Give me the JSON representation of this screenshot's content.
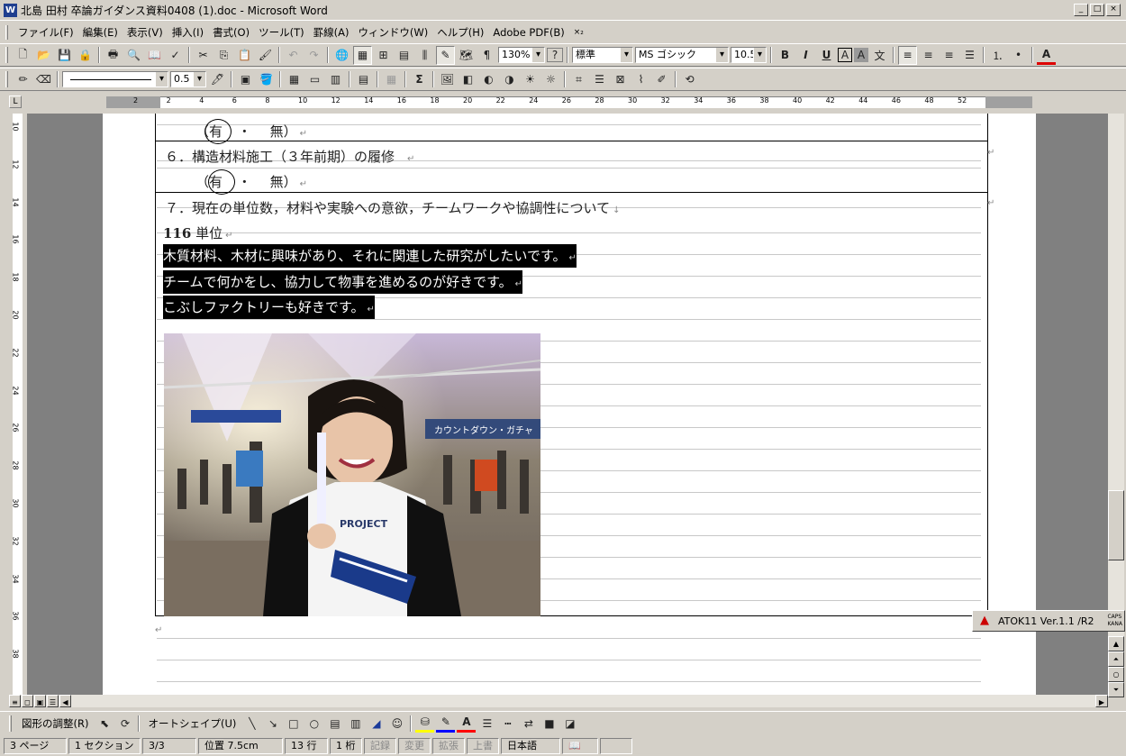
{
  "window": {
    "title": "北島 田村 卒論ガイダンス資料0408 (1).doc - Microsoft Word",
    "app_icon": "W",
    "controls": [
      "minimize-icon",
      "restore-icon",
      "close-icon"
    ]
  },
  "menu": {
    "items": [
      "ファイル(F)",
      "編集(E)",
      "表示(V)",
      "挿入(I)",
      "書式(O)",
      "ツール(T)",
      "罫線(A)",
      "ウィンドウ(W)",
      "ヘルプ(H)",
      "Adobe PDF(B)"
    ],
    "close_glyph": "×₂"
  },
  "toolbar_standard": {
    "zoom": "130%",
    "help_glyph": "?"
  },
  "toolbar_formatting": {
    "style": "標準",
    "font": "MS ゴシック",
    "size": "10.5",
    "bold": "B",
    "italic": "I",
    "underline": "U",
    "char_border": "A",
    "char_shade": "A",
    "font_color": "A"
  },
  "toolbar_tables": {
    "line_width": "0.5",
    "sum_glyph": "Σ"
  },
  "ruler": {
    "tab_glyph": "L",
    "labels": [
      "2",
      "2",
      "4",
      "6",
      "8",
      "10",
      "12",
      "14",
      "16",
      "18",
      "20",
      "22",
      "24",
      "26",
      "28",
      "30",
      "32",
      "34",
      "36",
      "38",
      "40",
      "42",
      "44",
      "46",
      "48",
      "52"
    ]
  },
  "vruler": {
    "labels": [
      "10",
      "12",
      "14",
      "16",
      "18",
      "20",
      "22",
      "24",
      "26",
      "28",
      "30",
      "32",
      "34",
      "36",
      "38"
    ]
  },
  "document": {
    "row5_answer": {
      "yes": "有",
      "dot": "・",
      "no": "無）"
    },
    "item6": "６．構造材料施工（３年前期）の履修",
    "row6_answer": {
      "yes": "有",
      "dot": "・",
      "no": "無）"
    },
    "item7": "７．現在の単位数，材料や実験への意欲，チームワークや協調性について",
    "credits_num": "116",
    "credits_unit": "単位",
    "lines": [
      "木質材料、木材に興味があり、それに関連した研究がしたいです。",
      "チームで何かをし、協力して物事を進めるのが好きです。",
      "こぶしファクトリーも好きです。"
    ],
    "paren_open": "（",
    "photo_sign": "カウントダウン・ガチャ",
    "photo_shirt": "PROJECT"
  },
  "drawing_toolbar": {
    "adjust": "図形の調整(R)",
    "autoshape": "オートシェイプ(U)"
  },
  "statusbar": {
    "page": "3 ページ",
    "section": "1 セクション",
    "pages": "3/3",
    "position": "位置 7.5cm",
    "line": "13 行",
    "column": "1 桁",
    "rec": "記録",
    "trk": "変更",
    "ext": "拡張",
    "ovr": "上書",
    "lang": "日本語"
  },
  "atok": {
    "label": "ATOK11 Ver.1.1 /R2",
    "caps": "CAPS",
    "kana": "KANA"
  }
}
